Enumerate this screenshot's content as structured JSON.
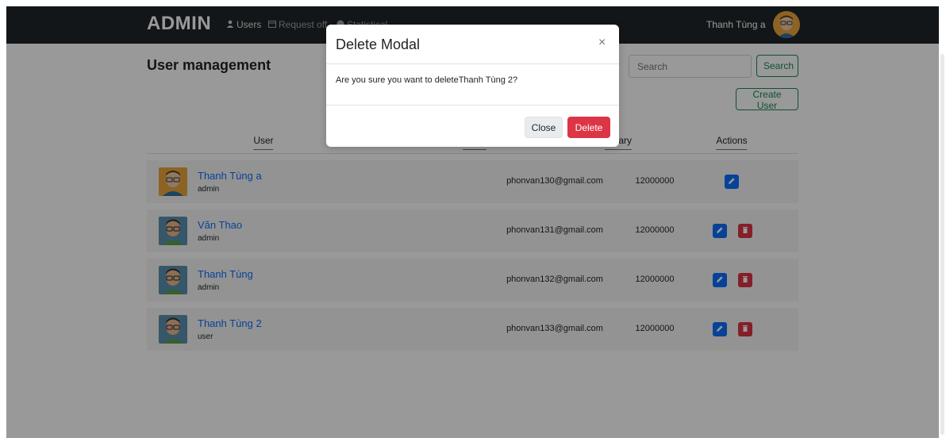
{
  "navbar": {
    "brand": "ADMIN",
    "items": [
      {
        "label": "Users",
        "icon": "user-icon"
      },
      {
        "label": "Request off",
        "icon": "calendar-icon"
      },
      {
        "label": "Statistical",
        "icon": "chart-icon"
      }
    ],
    "current_user": "Thanh Tùng a"
  },
  "page": {
    "title": "User management",
    "search_placeholder": "Search",
    "search_button": "Search",
    "create_button": "Create User"
  },
  "table": {
    "columns": [
      "User",
      "Email",
      "Salary",
      "Actions"
    ],
    "rows": [
      {
        "name": "Thanh Tùng a",
        "role": "admin",
        "email": "phonvan130@gmail.com",
        "salary": "12000000"
      },
      {
        "name": "Văn Thao",
        "role": "admin",
        "email": "phonvan131@gmail.com",
        "salary": "12000000"
      },
      {
        "name": "Thanh Tùng",
        "role": "admin",
        "email": "phonvan132@gmail.com",
        "salary": "12000000"
      },
      {
        "name": "Thanh Tùng 2",
        "role": "user",
        "email": "phonvan133@gmail.com",
        "salary": "12000000"
      }
    ]
  },
  "modal": {
    "title": "Delete Modal",
    "close_symbol": "×",
    "body": "Are you sure you want to deleteThanh Tùng 2?",
    "close_button": "Close",
    "delete_button": "Delete"
  },
  "colors": {
    "navbar": "#212529",
    "link": "#0d6efd",
    "success": "#198754",
    "danger": "#dc3545"
  }
}
